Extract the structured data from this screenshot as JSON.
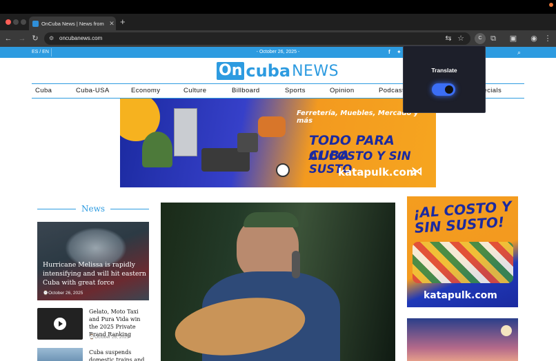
{
  "browser": {
    "tab_title": "OnCuba News | News from C",
    "url": "oncubanews.com",
    "profile_initial": "C",
    "accent": "#3b6ef5"
  },
  "site": {
    "lang_switch": "ES / EN",
    "date": "- October 26, 2025 -",
    "logo_on": "On",
    "logo_cuba": "cuba",
    "logo_news": "NEWS",
    "brand_color": "#2d9be0",
    "nav": [
      "Cuba",
      "Cuba-USA",
      "Economy",
      "Culture",
      "Billboard",
      "Sports",
      "Opinion",
      "Podcast",
      "Specials"
    ]
  },
  "banner": {
    "tagline": "Ferretería, Muebles, Mercado y más",
    "headline_1": "TODO PARA CUBA",
    "headline_2": "AL COSTO Y SIN SUSTO",
    "brand": "katapulk.com"
  },
  "news": {
    "section_title": "News",
    "items": [
      {
        "title": "Hurricane Melissa is rapidly intensifying and will hit eastern Cuba with great force",
        "date": "October 26, 2025"
      },
      {
        "title": "Gelato, Moto Taxi and Pura Vida win the 2025 Private Brand Ranking",
        "date": "October 26, 2025"
      },
      {
        "title": "Cuba suspends domestic trains and the",
        "date": ""
      }
    ]
  },
  "side_ad": {
    "headline": "¡AL COSTO Y SIN SUSTO!",
    "brand": "katapulk.com"
  },
  "popup": {
    "label": "Translate",
    "toggle_on": true
  }
}
